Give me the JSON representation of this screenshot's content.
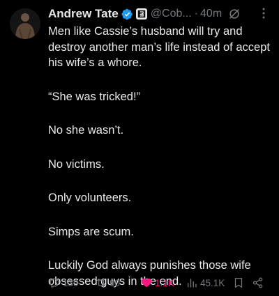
{
  "author": {
    "name": "Andrew Tate",
    "handle": "@Cob...",
    "separator": "·",
    "time": "40m"
  },
  "tweet": {
    "paragraphs": [
      "Men like Cassie’s husband will try and destroy another man’s life instead of accept his wife’s a whore.",
      "“She was tricked!”",
      "No she wasn’t.",
      "No victims.",
      "Only volunteers.",
      "Simps are scum.",
      "Luckily God always punishes those wife obsessed guys in the end."
    ]
  },
  "actions": {
    "replies": "139",
    "reposts": "90",
    "likes": "1.1K",
    "views": "45.1K"
  },
  "colors": {
    "background": "#000000",
    "text": "#e7e9ea",
    "muted": "#71767b",
    "verified": "#1d9bf0",
    "like": "#f91880"
  },
  "icons": [
    "verified-badge-icon",
    "affiliate-badge-icon",
    "grok-icon",
    "more-icon",
    "reply-icon",
    "repost-icon",
    "heart-icon",
    "views-icon",
    "bookmark-icon",
    "share-icon"
  ]
}
